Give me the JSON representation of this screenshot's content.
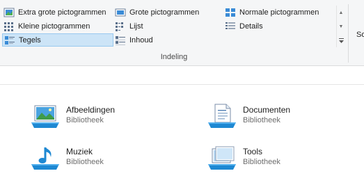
{
  "ribbon": {
    "layout_options": [
      {
        "label": "Extra grote pictogrammen",
        "icon": "extra-large-icons-icon",
        "selected": false
      },
      {
        "label": "Grote pictogrammen",
        "icon": "large-icons-icon",
        "selected": false
      },
      {
        "label": "Normale pictogrammen",
        "icon": "medium-icons-icon",
        "selected": false
      },
      {
        "label": "Kleine pictogrammen",
        "icon": "small-icons-icon",
        "selected": false
      },
      {
        "label": "Lijst",
        "icon": "list-icon",
        "selected": false
      },
      {
        "label": "Details",
        "icon": "details-icon",
        "selected": false
      },
      {
        "label": "Tegels",
        "icon": "tiles-icon",
        "selected": true
      },
      {
        "label": "Inhoud",
        "icon": "content-icon",
        "selected": false
      }
    ],
    "group_label": "Indeling",
    "next_group_fragment": "So"
  },
  "files": [
    {
      "name": "Afbeeldingen",
      "type": "Bibliotheek",
      "icon": "pictures-library-icon"
    },
    {
      "name": "Documenten",
      "type": "Bibliotheek",
      "icon": "documents-library-icon"
    },
    {
      "name": "Muziek",
      "type": "Bibliotheek",
      "icon": "music-library-icon"
    },
    {
      "name": "Tools",
      "type": "Bibliotheek",
      "icon": "tools-library-icon"
    }
  ],
  "colors": {
    "ribbon_bg": "#f5f6f7",
    "selection_bg": "#cce4f7",
    "selection_border": "#99c9ef",
    "library_blue": "#1e88d2",
    "secondary_text": "#6d6d6d"
  }
}
